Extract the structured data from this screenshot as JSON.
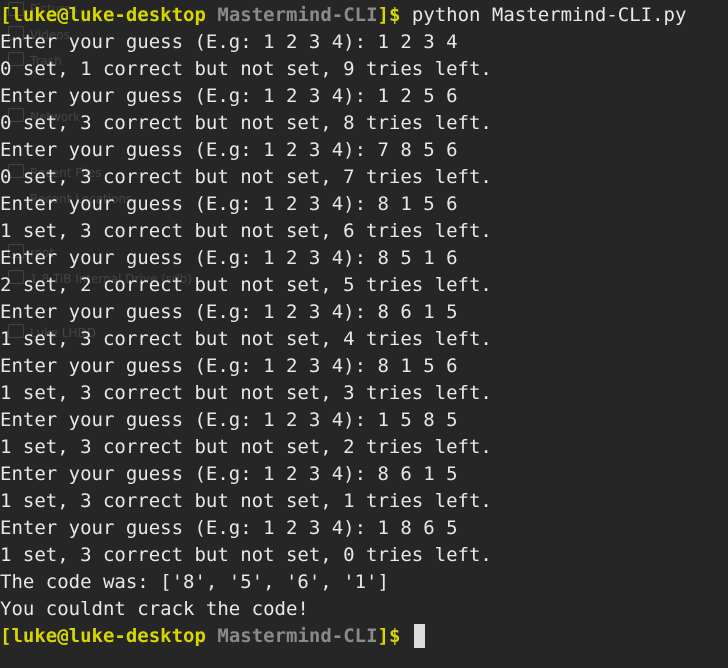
{
  "terminal": {
    "prompt": {
      "open": "[",
      "user_host": "luke@luke-desktop",
      "space": " ",
      "cwd": "Mastermind-CLI",
      "close": "]$",
      "command": " python Mastermind-CLI.py"
    },
    "output_lines": [
      "Enter your guess (E.g: 1 2 3 4): 1 2 3 4",
      "0 set, 1 correct but not set, 9 tries left.",
      "Enter your guess (E.g: 1 2 3 4): 1 2 5 6",
      "0 set, 3 correct but not set, 8 tries left.",
      "Enter your guess (E.g: 1 2 3 4): 7 8 5 6",
      "0 set, 3 correct but not set, 7 tries left.",
      "Enter your guess (E.g: 1 2 3 4): 8 1 5 6",
      "1 set, 3 correct but not set, 6 tries left.",
      "Enter your guess (E.g: 1 2 3 4): 8 5 1 6",
      "2 set, 2 correct but not set, 5 tries left.",
      "Enter your guess (E.g: 1 2 3 4): 8 6 1 5",
      "1 set, 3 correct but not set, 4 tries left.",
      "Enter your guess (E.g: 1 2 3 4): 8 1 5 6",
      "1 set, 3 correct but not set, 3 tries left.",
      "Enter your guess (E.g: 1 2 3 4): 1 5 8 5",
      "1 set, 3 correct but not set, 2 tries left.",
      "Enter your guess (E.g: 1 2 3 4): 8 6 1 5",
      "1 set, 3 correct but not set, 1 tries left.",
      "Enter your guess (E.g: 1 2 3 4): 1 8 6 5",
      "1 set, 3 correct but not set, 0 tries left.",
      "The code was: ['8', '5', '6', '1']",
      "You couldnt crack the code!"
    ],
    "background_sidebar_ghost": [
      "Pictures",
      "Videos",
      "Trash",
      "Network",
      "Recent Files",
      "Recent Locations",
      "root",
      "1.8 TiB Internal Drive (sdb)",
      "Luke LHDD"
    ]
  }
}
